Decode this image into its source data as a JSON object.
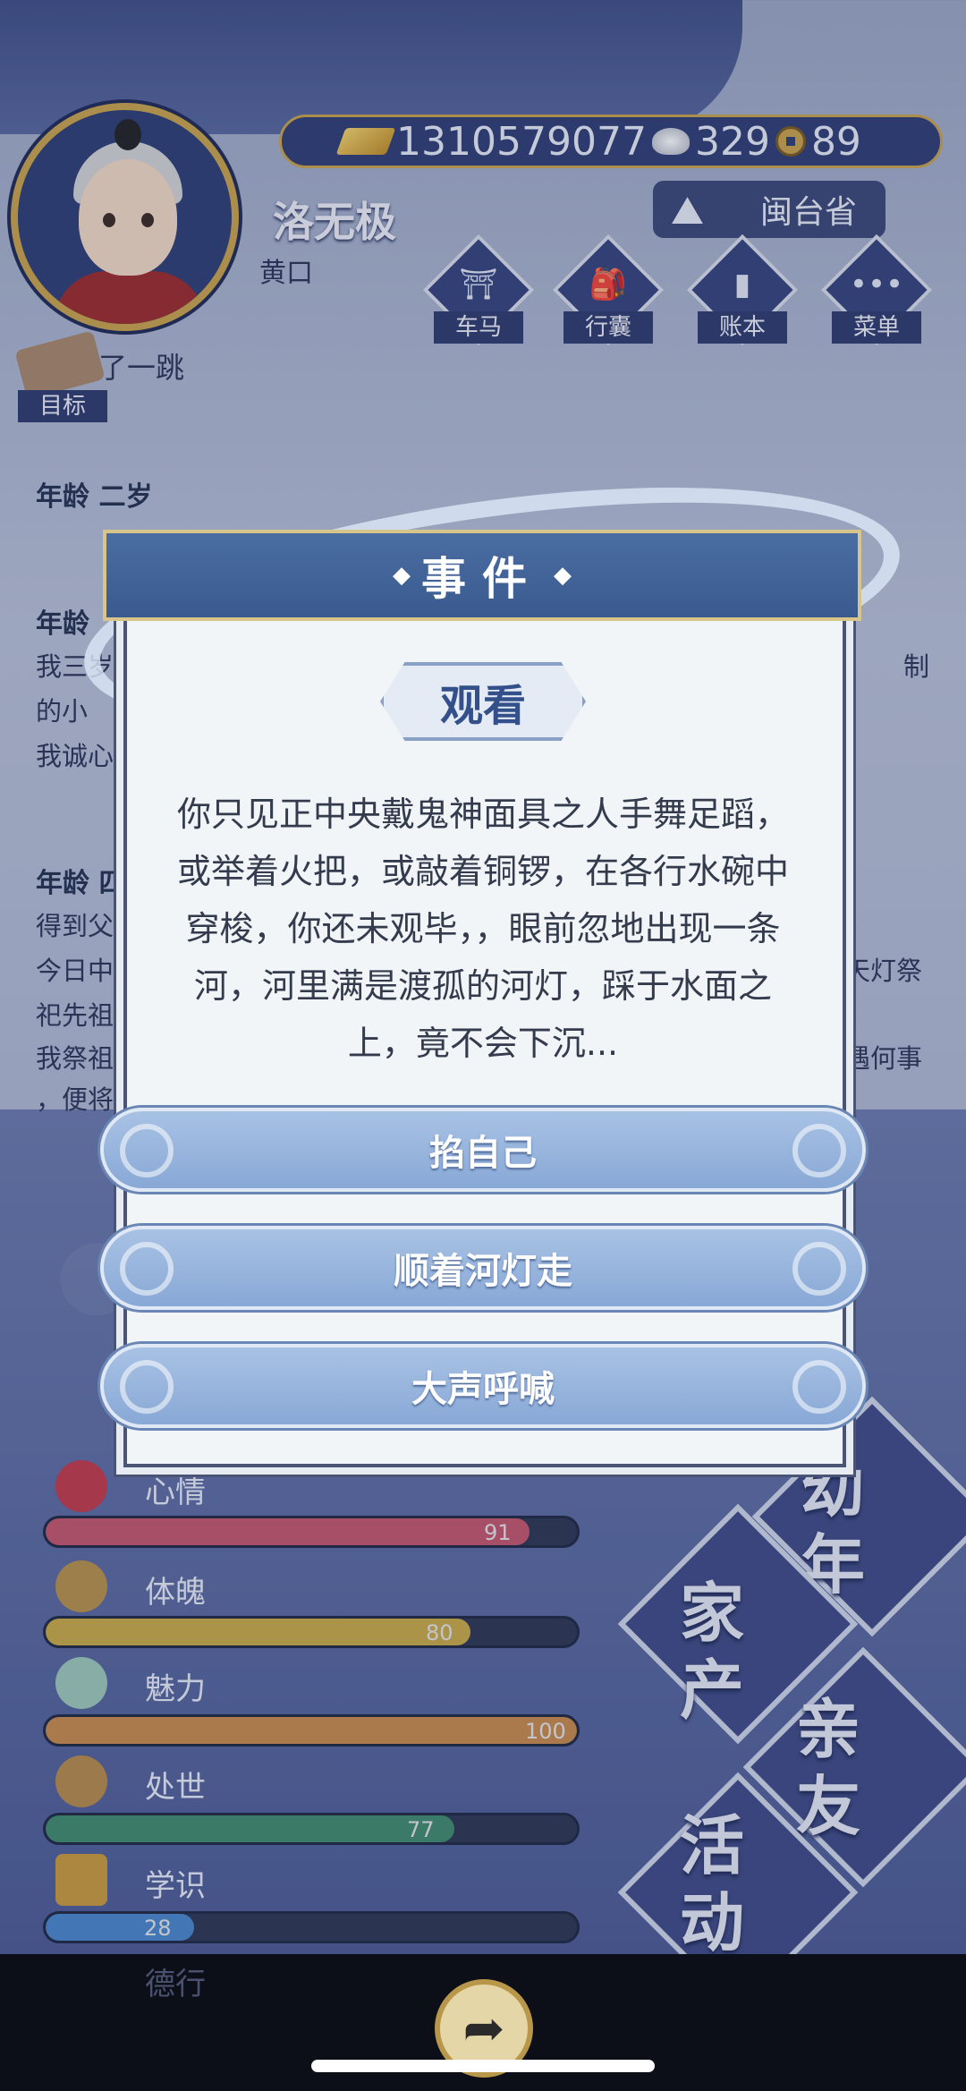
{
  "player": {
    "name": "洛无极",
    "title": "黄口"
  },
  "currency": {
    "gold": "1310579077",
    "silver": "329",
    "coins": "89"
  },
  "location": "闽台省",
  "menu": [
    {
      "label": "车马",
      "icon": "carriage-icon"
    },
    {
      "label": "行囊",
      "icon": "bag-icon"
    },
    {
      "label": "账本",
      "icon": "ledger-icon"
    },
    {
      "label": "菜单",
      "icon": "more-icon"
    }
  ],
  "goal": {
    "label": "目标",
    "text": "了一跳"
  },
  "log": {
    "age1": "年龄 二岁",
    "age2_partial": "年龄",
    "line_a": "我三岁",
    "line_a_r": "制",
    "line_b": "的小",
    "line_c": "我诚心",
    "age3_partial": "年龄 四",
    "line_d": "得到父",
    "line_e": "今日中",
    "line_e_r": "天灯祭",
    "line_f": "祀先祖",
    "line_g": "我祭祖",
    "line_g_r": "遇何事",
    "line_h": "，便将"
  },
  "event": {
    "header": "事件",
    "tag": "观看",
    "text": "你只见正中央戴鬼神面具之人手舞足蹈，或举着火把，或敲着铜锣，在各行水碗中穿梭，你还未观毕，，眼前忽地出现一条河，河里满是渡孤的河灯，踩于水面之上，竟不会下沉...",
    "choices": [
      "掐自己",
      "顺着河灯走",
      "大声呼喊"
    ]
  },
  "stats": [
    {
      "label": "心情",
      "value": "91",
      "fraction": 0.91,
      "color": "#c4566a",
      "icon": "flower-icon"
    },
    {
      "label": "体魄",
      "value": "80",
      "fraction": 0.8,
      "color": "#c8a945",
      "icon": "body-icon"
    },
    {
      "label": "魅力",
      "value": "100",
      "fraction": 1.0,
      "color": "#c88a4a",
      "icon": "charm-icon"
    },
    {
      "label": "处世",
      "value": "77",
      "fraction": 0.77,
      "color": "#3f8a6a",
      "icon": "social-icon"
    },
    {
      "label": "学识",
      "value": "28",
      "fraction": 0.28,
      "color": "#4a86c8",
      "icon": "books-icon"
    },
    {
      "label": "德行",
      "value": "",
      "fraction": 0.0,
      "color": "#7a3a5a",
      "icon": "virtue-icon"
    }
  ],
  "sections": {
    "youth": "幼年",
    "property": "家产",
    "family": "亲友",
    "activity": "活动"
  }
}
